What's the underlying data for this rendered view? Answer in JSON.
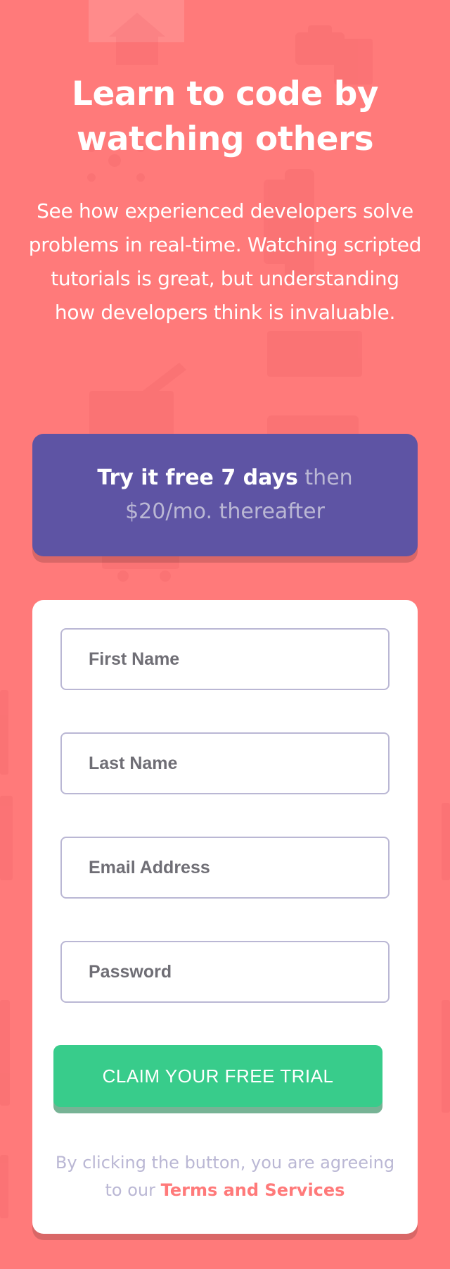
{
  "hero": {
    "headline": "Learn to code by watching others",
    "description": "See how experienced developers solve problems in real-time. Watching scripted tutorials is great, but understanding how developers think is invaluable."
  },
  "trial_banner": {
    "highlight": "Try it free 7 days",
    "rest": " then $20/mo. thereafter"
  },
  "form": {
    "fields": [
      {
        "placeholder": "First Name",
        "value": ""
      },
      {
        "placeholder": "Last Name",
        "value": ""
      },
      {
        "placeholder": "Email Address",
        "value": ""
      },
      {
        "placeholder": "Password",
        "value": ""
      }
    ],
    "submit_label": "CLAIM YOUR FREE TRIAL",
    "terms_prefix": "By clicking the button, you are agreeing to our ",
    "terms_link": "Terms and Services"
  },
  "colors": {
    "background": "#ff7a7a",
    "banner": "#5e54a4",
    "cta": "#38cc8b",
    "field_border": "#bab7d4",
    "muted_text": "#bab7d4"
  },
  "icons": [
    "house-icon",
    "suitcase-icon",
    "network-icon",
    "pencil-icon",
    "document-icon",
    "cart-icon",
    "calendar-icon"
  ]
}
